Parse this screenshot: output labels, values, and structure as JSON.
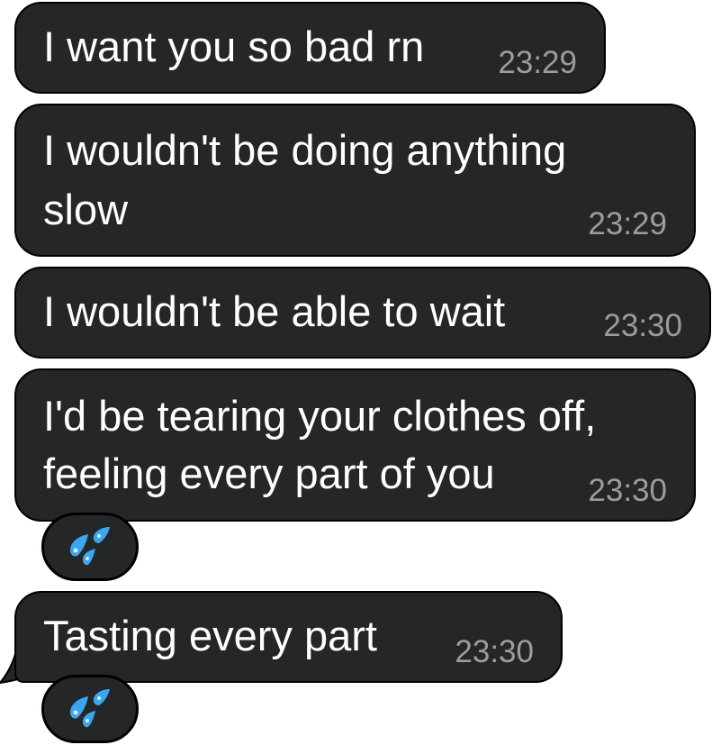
{
  "messages": [
    {
      "text_lines": [
        "I want you so bad rn"
      ],
      "time": "23:29"
    },
    {
      "text_lines": [
        "I wouldn't be doing anything",
        "slow"
      ],
      "time": "23:29"
    },
    {
      "text_lines": [
        "I wouldn't be able to wait"
      ],
      "time": "23:30"
    },
    {
      "text_lines": [
        "I'd be tearing your clothes off,",
        "feeling every part of you"
      ],
      "time": "23:30",
      "reaction": "sweat-droplets-icon"
    },
    {
      "text_lines": [
        "Tasting every part"
      ],
      "time": "23:30",
      "reaction": "sweat-droplets-icon"
    }
  ],
  "colors": {
    "bubble": "#242627",
    "text": "#ffffff",
    "timestamp": "#9a9c9e",
    "droplet": "#3ba6f0"
  }
}
